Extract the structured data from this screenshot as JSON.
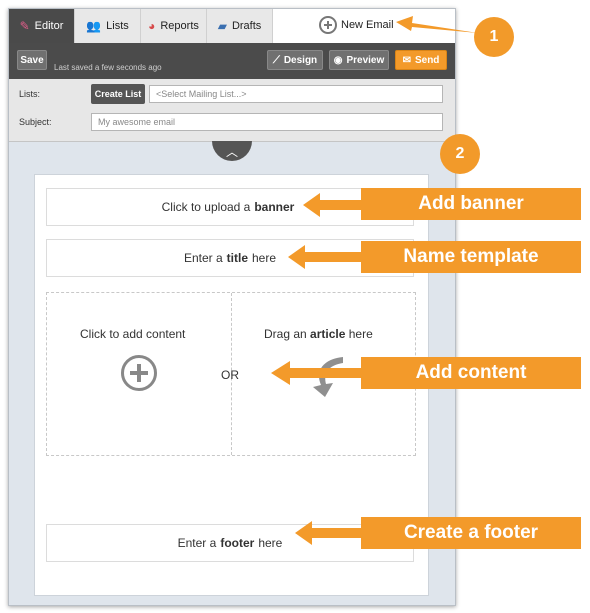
{
  "tabs": [
    {
      "label": "Editor",
      "icon": "pencil-icon"
    },
    {
      "label": "Lists",
      "icon": "users-icon"
    },
    {
      "label": "Reports",
      "icon": "pie-chart-icon"
    },
    {
      "label": "Drafts",
      "icon": "folder-icon"
    }
  ],
  "new_email_label": "New Email",
  "toolbar": {
    "save_label": "Save",
    "saved_status": "Last saved a few seconds ago",
    "design_label": "Design",
    "preview_label": "Preview",
    "send_label": "Send"
  },
  "form": {
    "lists_label": "Lists:",
    "create_list_label": "Create List",
    "mailing_list_placeholder": "<Select Mailing List...>",
    "subject_label": "Subject:",
    "subject_placeholder": "My awesome email"
  },
  "template": {
    "banner_pre": "Click to upload a",
    "banner_bold": "banner",
    "title_pre": "Enter a",
    "title_bold": "title",
    "title_post": "here",
    "add_content": "Click to add content",
    "or_label": "OR",
    "article_pre": "Drag an",
    "article_bold": "article",
    "article_post": "here",
    "footer_pre": "Enter a",
    "footer_bold": "footer",
    "footer_post": "here"
  },
  "annotations": {
    "badge1": "1",
    "badge2": "2",
    "add_banner": "Add banner",
    "name_template": "Name template",
    "add_content": "Add content",
    "create_footer": "Create a footer"
  },
  "colors": {
    "accent_orange": "#f39a2a",
    "toolbar_gray": "#4b4b4b",
    "frame_bg": "#dfe5ec"
  }
}
